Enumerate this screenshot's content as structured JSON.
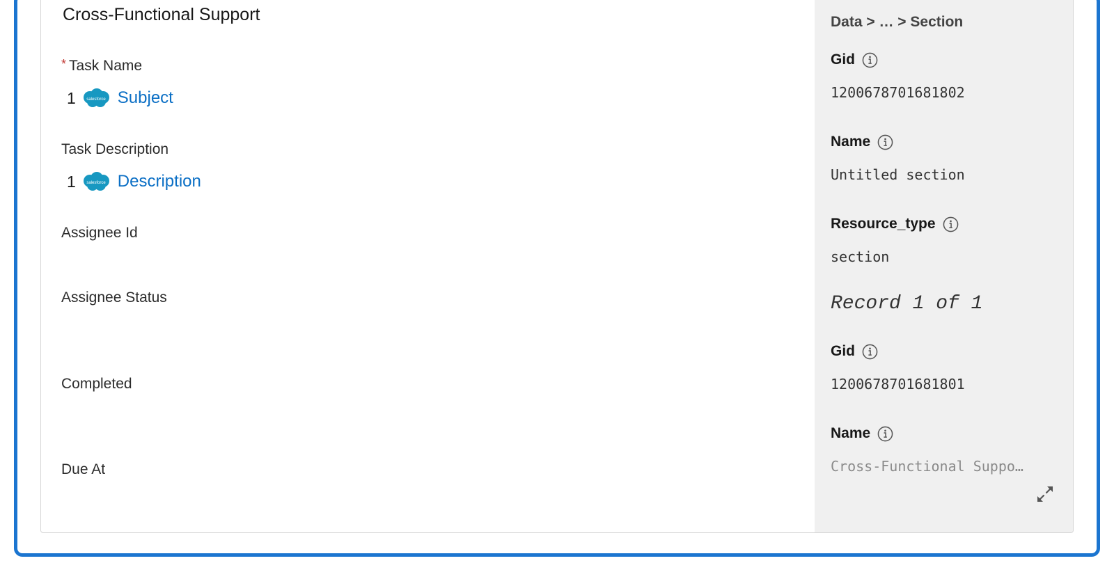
{
  "form": {
    "section_title": "Cross-Functional Support",
    "fields": {
      "task_name": {
        "required_marker": "*",
        "label": "Task Name",
        "mapping": {
          "index": "1",
          "source_icon": "salesforce-cloud-icon",
          "value": "Subject"
        }
      },
      "task_description": {
        "label": "Task Description",
        "mapping": {
          "index": "1",
          "source_icon": "salesforce-cloud-icon",
          "value": "Description"
        }
      },
      "assignee_id": {
        "label": "Assignee Id"
      },
      "assignee_status": {
        "label": "Assignee Status"
      },
      "completed": {
        "label": "Completed"
      },
      "due_at": {
        "label": "Due At"
      }
    }
  },
  "side_panel": {
    "breadcrumb": "Data > … > Section",
    "section_record": {
      "props": [
        {
          "label": "Gid",
          "value": "1200678701681802"
        },
        {
          "label": "Name",
          "value": "Untitled section"
        },
        {
          "label": "Resource_type",
          "value": "section"
        }
      ]
    },
    "record_heading": "Record 1 of 1",
    "record": {
      "props": [
        {
          "label": "Gid",
          "value": "1200678701681801"
        },
        {
          "label": "Name",
          "value": "Cross-Functional Suppo…"
        }
      ]
    }
  },
  "colors": {
    "frame_border": "#1b75d0",
    "link": "#0b6fc5",
    "required": "#c23934",
    "salesforce_cloud": "#1798c1",
    "panel_bg": "#f0f0f0"
  }
}
